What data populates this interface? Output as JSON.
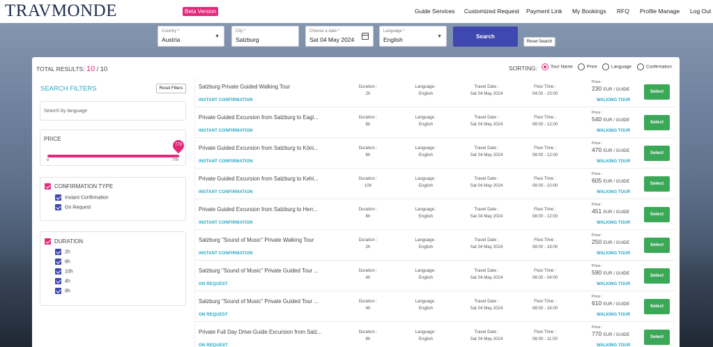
{
  "header": {
    "logo": "TRAVMONDE",
    "beta_badge": "Beta Version",
    "nav": [
      "Guide Services",
      "Customized Request",
      "Payment Link",
      "My Bookings",
      "RFQ",
      "Profile Manage",
      "Log Out"
    ]
  },
  "search": {
    "country": {
      "label": "Country *",
      "value": "Austria"
    },
    "city": {
      "label": "City *",
      "value": "Salzburg"
    },
    "date": {
      "label": "Choose a date *",
      "value": "Sat 04 May 2024"
    },
    "language": {
      "label": "Language *",
      "value": "English"
    },
    "search_button": "Search",
    "reset_button": "Reset Search"
  },
  "results": {
    "total_label": "TOTAL RESULTS:",
    "count": "10",
    "separator": "/",
    "total": "10",
    "sorting_label": "SORTING:",
    "sort_options": [
      "Tour Name",
      "Price",
      "Language",
      "Confirmation"
    ],
    "sort_selected": "Tour Name"
  },
  "filters": {
    "title": "SEARCH FILTERS",
    "reset": "Reset Filters",
    "language_placeholder": "Search by language",
    "price": {
      "title": "PRICE",
      "min": "0",
      "max": "770",
      "current": "770"
    },
    "confirmation": {
      "title": "CONFIRMATION TYPE",
      "options": [
        "Instant Confirmation",
        "On Request"
      ]
    },
    "duration": {
      "title": "DURATION",
      "options": [
        "2h",
        "6h",
        "10h",
        "4h",
        "8h"
      ]
    }
  },
  "column_labels": {
    "duration": "Duration :",
    "language": "Language :",
    "travel_date": "Travel Date :",
    "flexi_time": "Flexi Time :",
    "price": "Price :",
    "select": "Select"
  },
  "tours": [
    {
      "name": "Salzburg Private Guided Walking Tour",
      "confirmation": "INSTANT CONFIRMATION",
      "duration": "2h",
      "language": "English",
      "date": "Sat 04 May 2024",
      "flexi": "04:00 - 23:00",
      "price": "230",
      "unit": "EUR / GUIDE",
      "type": "WALKING TOUR"
    },
    {
      "name": "Private Guided Excursion from Salzburg to Eagl...",
      "confirmation": "INSTANT CONFIRMATION",
      "duration": "6h",
      "language": "English",
      "date": "Sat 04 May 2024",
      "flexi": "08:00 - 12:00",
      "price": "540",
      "unit": "EUR / GUIDE",
      "type": "WALKING TOUR"
    },
    {
      "name": "Private Guided Excursion from Salzburg to Köni...",
      "confirmation": "INSTANT CONFIRMATION",
      "duration": "6h",
      "language": "English",
      "date": "Sat 04 May 2024",
      "flexi": "08:00 - 12:00",
      "price": "470",
      "unit": "EUR / GUIDE",
      "type": "WALKING TOUR"
    },
    {
      "name": "Private Guided Excursion from Salzburg to Kehl...",
      "confirmation": "INSTANT CONFIRMATION",
      "duration": "10h",
      "language": "English",
      "date": "Sat 04 May 2024",
      "flexi": "08:00 - 10:00",
      "price": "605",
      "unit": "EUR / GUIDE",
      "type": "WALKING TOUR"
    },
    {
      "name": "Private Guided Excursion from Salzburg to Herr...",
      "confirmation": "INSTANT CONFIRMATION",
      "duration": "6h",
      "language": "English",
      "date": "Sat 04 May 2024",
      "flexi": "08:00 - 12:00",
      "price": "451",
      "unit": "EUR / GUIDE",
      "type": "WALKING TOUR"
    },
    {
      "name": "Salzburg \"Sound of Music\" Private Walking Tour",
      "confirmation": "INSTANT CONFIRMATION",
      "duration": "2h",
      "language": "English",
      "date": "Sat 04 May 2024",
      "flexi": "08:00 - 19:00",
      "price": "250",
      "unit": "EUR / GUIDE",
      "type": "WALKING TOUR"
    },
    {
      "name": "Salzburg \"Sound of Music\" Private Guided Tour ...",
      "confirmation": "ON REQUEST",
      "duration": "4h",
      "language": "English",
      "date": "Sat 04 May 2024",
      "flexi": "08:00 - 04:00",
      "price": "590",
      "unit": "EUR / GUIDE",
      "type": "WALKING TOUR"
    },
    {
      "name": "Salzburg \"Sound of Music\" Private Guided Tour ...",
      "confirmation": "ON REQUEST",
      "duration": "4h",
      "language": "English",
      "date": "Sat 04 May 2024",
      "flexi": "08:00 - 16:00",
      "price": "610",
      "unit": "EUR / GUIDE",
      "type": "WALKING TOUR"
    },
    {
      "name": "Private Full Day Drive-Guide Excursion from Salz...",
      "confirmation": "ON REQUEST",
      "duration": "8h",
      "language": "English",
      "date": "Sat 04 May 2024",
      "flexi": "08:00 - 11:00",
      "price": "770",
      "unit": "EUR / GUIDE",
      "type": "WALKING TOUR"
    }
  ],
  "colors": {
    "brand_navy": "#1f2d4f",
    "accent_pink": "#e3287a",
    "accent_teal": "#2aa6c2",
    "button_blue": "#3f48b0",
    "select_green": "#3aa857"
  }
}
